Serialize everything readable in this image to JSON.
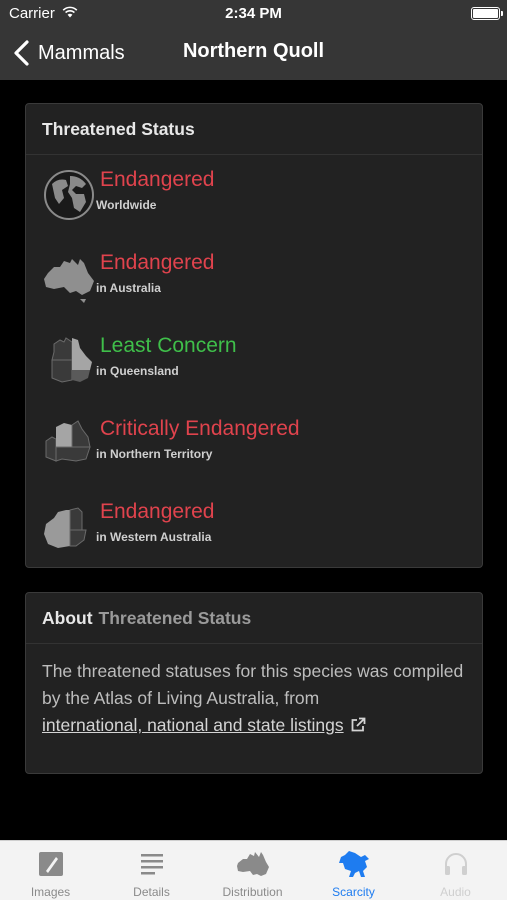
{
  "status_bar": {
    "carrier": "Carrier",
    "time": "2:34 PM"
  },
  "nav": {
    "back_label": "Mammals",
    "title": "Northern Quoll"
  },
  "threatened": {
    "header": "Threatened Status",
    "rows": [
      {
        "status": "Endangered",
        "scope": "Worldwide",
        "icon": "globe-icon",
        "color": "#e0434d"
      },
      {
        "status": "Endangered",
        "scope": "in Australia",
        "icon": "australia-map-icon",
        "color": "#e0434d"
      },
      {
        "status": "Least Concern",
        "scope": "in Queensland",
        "icon": "queensland-map-icon",
        "color": "#3fbf4a"
      },
      {
        "status": "Critically Endangered",
        "scope": "in Northern Territory",
        "icon": "northern-territory-map-icon",
        "color": "#e0434d"
      },
      {
        "status": "Endangered",
        "scope": "in Western Australia",
        "icon": "western-australia-map-icon",
        "color": "#e0434d"
      }
    ]
  },
  "about": {
    "header_main": "About",
    "header_sub": "Threatened Status",
    "text": "The threatened statuses for this species was compiled by the Atlas of Living Australia, from",
    "link_label": "international, national and state listings"
  },
  "tabs": [
    {
      "label": "Images",
      "icon": "images-icon",
      "state": "normal"
    },
    {
      "label": "Details",
      "icon": "details-icon",
      "state": "normal"
    },
    {
      "label": "Distribution",
      "icon": "distribution-icon",
      "state": "normal"
    },
    {
      "label": "Scarcity",
      "icon": "scarcity-icon",
      "state": "active"
    },
    {
      "label": "Audio",
      "icon": "audio-icon",
      "state": "disabled"
    }
  ],
  "colors": {
    "active_tab": "#1e7cf0",
    "endangered": "#e0434d",
    "least_concern": "#3fbf4a"
  }
}
